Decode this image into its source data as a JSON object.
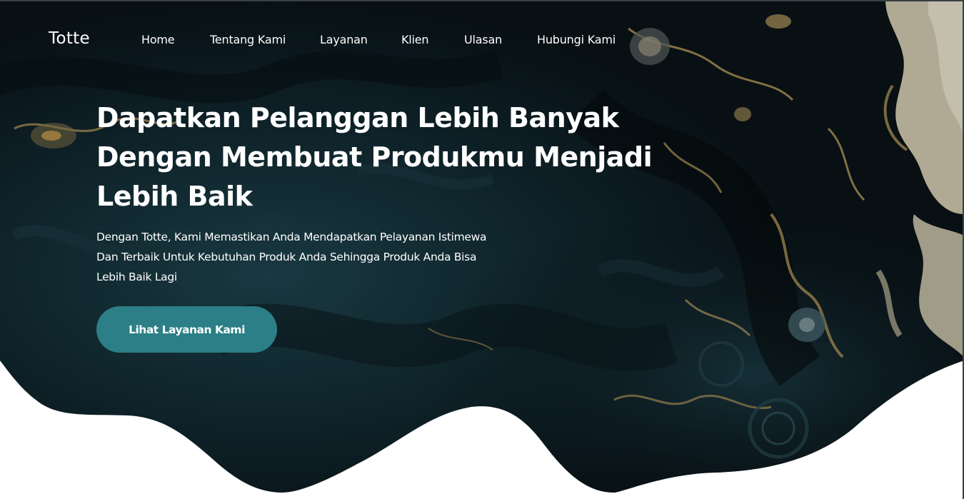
{
  "brand": {
    "name": "Totte"
  },
  "nav": {
    "items": [
      {
        "label": "Home"
      },
      {
        "label": "Tentang Kami"
      },
      {
        "label": "Layanan"
      },
      {
        "label": "Klien"
      },
      {
        "label": "Ulasan"
      },
      {
        "label": "Hubungi Kami"
      }
    ]
  },
  "hero": {
    "title": "Dapatkan Pelanggan Lebih Banyak Dengan Membuat Produkmu Menjadi Lebih Baik",
    "subtitle": "Dengan Totte, Kami Memastikan Anda Mendapatkan Pelayanan Istimewa Dan Terbaik Untuk Kebutuhan Produk Anda Sehingga Produk Anda Bisa Lebih Baik Lagi",
    "cta_label": "Lihat Layanan Kami"
  },
  "colors": {
    "accent": "#2c7f86",
    "hero_dark": "#0f1d22",
    "marble_gold": "#b79a5c",
    "marble_cream": "#e9e1c4",
    "text": "#ffffff",
    "background": "#ffffff"
  }
}
